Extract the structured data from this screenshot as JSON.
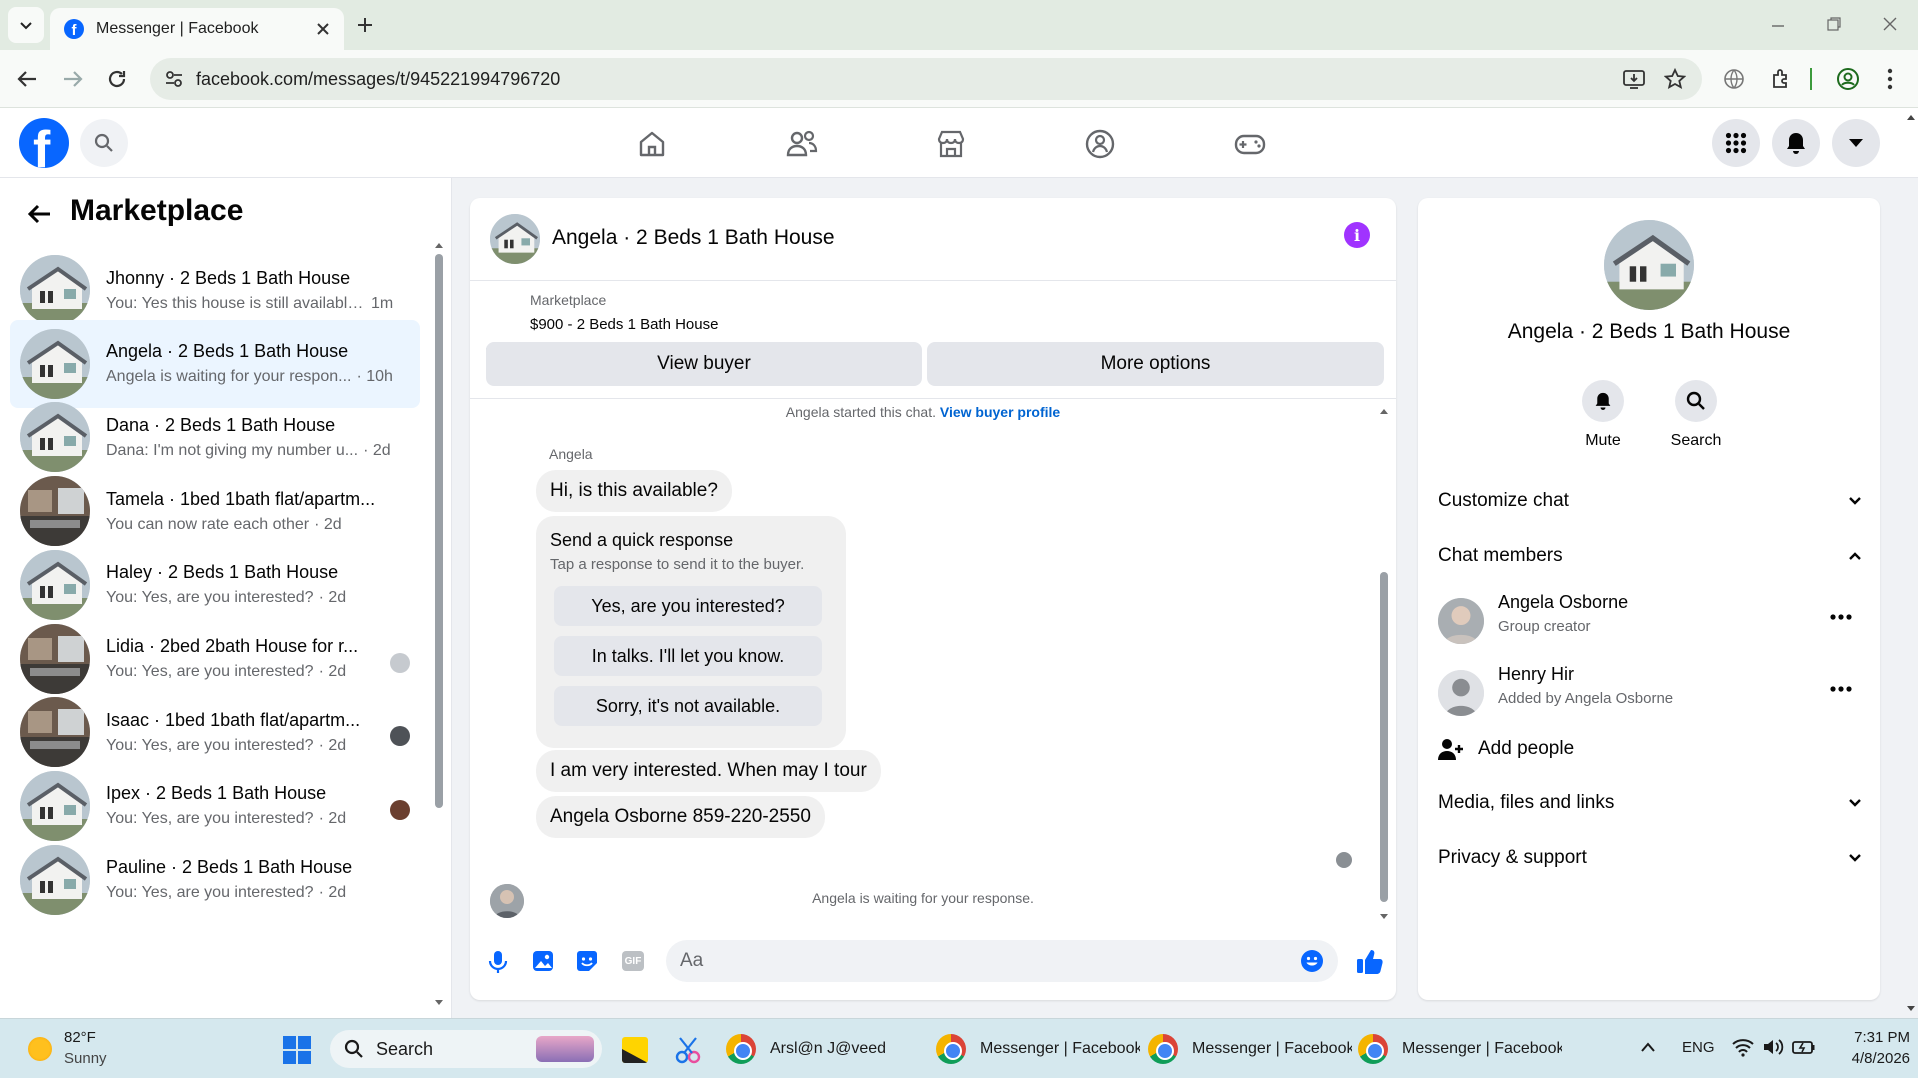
{
  "browser": {
    "tab_title": "Messenger | Facebook",
    "url": "facebook.com/messages/t/945221994796720"
  },
  "left": {
    "title": "Marketplace",
    "conversations": [
      {
        "name": "Jhonny · 2 Beds 1 Bath House",
        "preview": "You: Yes this house is still available ...",
        "time": "1m"
      },
      {
        "name": "Angela · 2 Beds 1 Bath House",
        "preview": "Angela is waiting for your respon...",
        "time": "· 10h"
      },
      {
        "name": "Dana · 2 Beds 1 Bath House",
        "preview": "Dana: I'm not giving my number u...",
        "time": "· 2d"
      },
      {
        "name": "Tamela · 1bed 1bath flat/apartm...",
        "preview": "You can now rate each other",
        "time": "· 2d"
      },
      {
        "name": "Haley · 2 Beds 1 Bath House",
        "preview": "You: Yes, are you interested?",
        "time": "· 2d"
      },
      {
        "name": "Lidia · 2bed 2bath House for r...",
        "preview": "You: Yes, are you interested?",
        "time": "· 2d"
      },
      {
        "name": "Isaac · 1bed 1bath flat/apartm...",
        "preview": "You: Yes, are you interested?",
        "time": "· 2d"
      },
      {
        "name": "Ipex · 2 Beds 1 Bath House",
        "preview": "You: Yes, are you interested?",
        "time": "· 2d"
      },
      {
        "name": "Pauline · 2 Beds 1 Bath House",
        "preview": "You: Yes, are you interested?",
        "time": "· 2d"
      }
    ]
  },
  "chat": {
    "title": "Angela · 2 Beds 1 Bath House",
    "listing_label": "Marketplace",
    "listing_price": "$900 - 2 Beds 1 Bath House",
    "view_buyer": "View buyer",
    "more_options": "More options",
    "started_text": "Angela started this chat.",
    "view_profile": "View buyer profile",
    "sender": "Angela",
    "msg1": "Hi, is this available?",
    "quick_title": "Send a quick response",
    "quick_sub": "Tap a response to send it to the buyer.",
    "quick_replies": [
      "Yes, are you interested?",
      "In talks. I'll let you know.",
      "Sorry, it's not available."
    ],
    "msg2": "I am very interested. When may I tour",
    "msg3": "Angela Osborne 859-220-2550",
    "waiting": "Angela is waiting for your response.",
    "input_placeholder": "Aa"
  },
  "info": {
    "title": "Angela · 2 Beds 1 Bath House",
    "mute": "Mute",
    "search": "Search",
    "customize": "Customize chat",
    "members_label": "Chat members",
    "members": [
      {
        "name": "Angela Osborne",
        "role": "Group creator"
      },
      {
        "name": "Henry Hir",
        "role": "Added by Angela Osborne"
      }
    ],
    "add_people": "Add people",
    "media": "Media, files and links",
    "privacy": "Privacy & support"
  },
  "taskbar": {
    "temp": "82°F",
    "weather": "Sunny",
    "search": "Search",
    "apps": [
      "Arsl@n J@veed FB Mi",
      "Messenger | Facebook",
      "Messenger | Facebook",
      "Messenger | Facebook"
    ],
    "lang": "ENG",
    "time": "7:31 PM",
    "date": "4/8/2026"
  },
  "colors": {
    "fb_blue": "#0866ff",
    "link": "#0064d1",
    "purple": "#a033ff",
    "active_bg": "#ebf5ff"
  }
}
